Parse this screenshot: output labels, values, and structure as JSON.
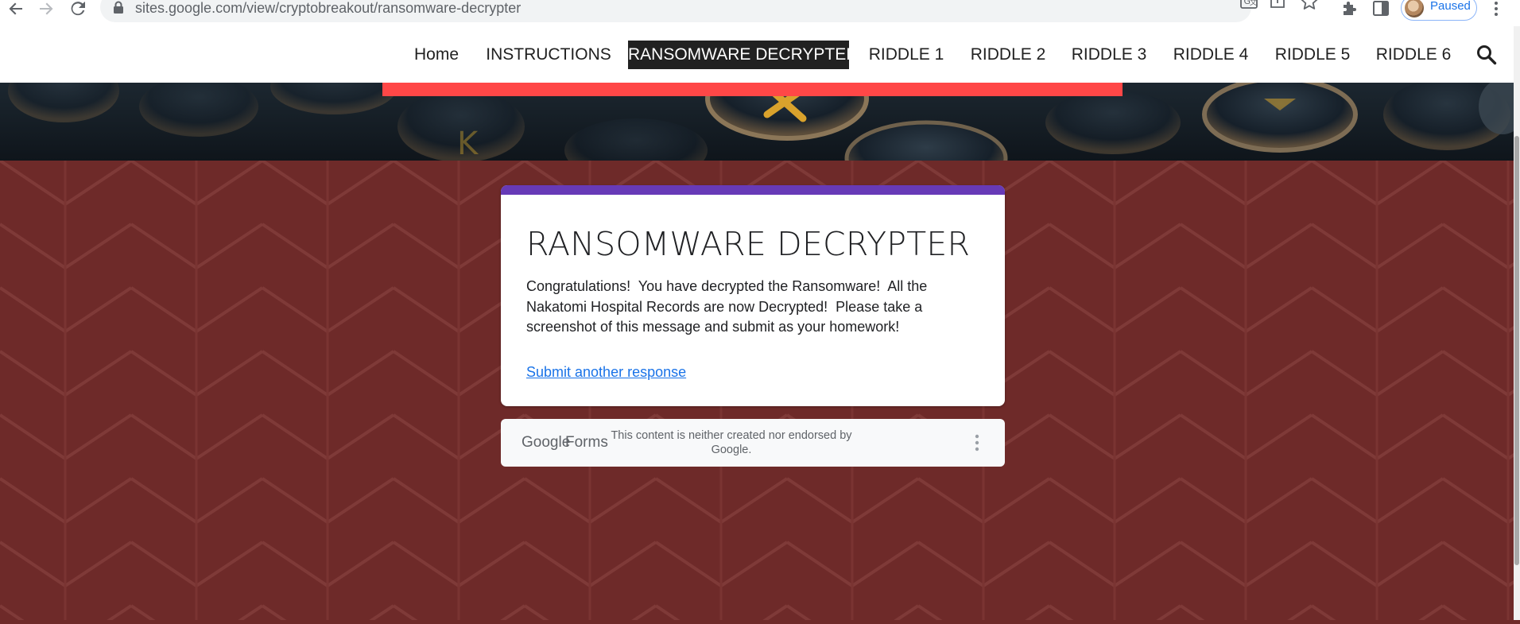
{
  "browser": {
    "url": "sites.google.com/view/cryptobreakout/ransomware-decrypter",
    "profile_status": "Paused"
  },
  "nav": {
    "items": [
      {
        "label": "Home",
        "active": false
      },
      {
        "label": "INSTRUCTIONS",
        "active": false
      },
      {
        "label": "RANSOMWARE DECRYPTER",
        "active": true
      },
      {
        "label": "RIDDLE 1",
        "active": false
      },
      {
        "label": "RIDDLE 2",
        "active": false
      },
      {
        "label": "RIDDLE 3",
        "active": false
      },
      {
        "label": "RIDDLE 4",
        "active": false
      },
      {
        "label": "RIDDLE 5",
        "active": false
      },
      {
        "label": "RIDDLE 6",
        "active": false
      }
    ],
    "search_icon": "search-icon"
  },
  "form": {
    "title": "RANSOMWARE DECRYPTER",
    "message": "Congratulations!  You have decrypted the Ransomware!  All the Nakatomi Hospital Records are now Decrypted!  Please take a screenshot of this message and submit as your homework!",
    "link": "Submit another response"
  },
  "footer": {
    "brand_google": "Google",
    "brand_forms": "Forms",
    "disclaimer": "This content is neither created nor endorsed by Google."
  },
  "colors": {
    "accent_red": "#ff4747",
    "form_purple": "#673ab7",
    "background_maroon": "#6e2a29",
    "link_blue": "#1a73e8"
  }
}
